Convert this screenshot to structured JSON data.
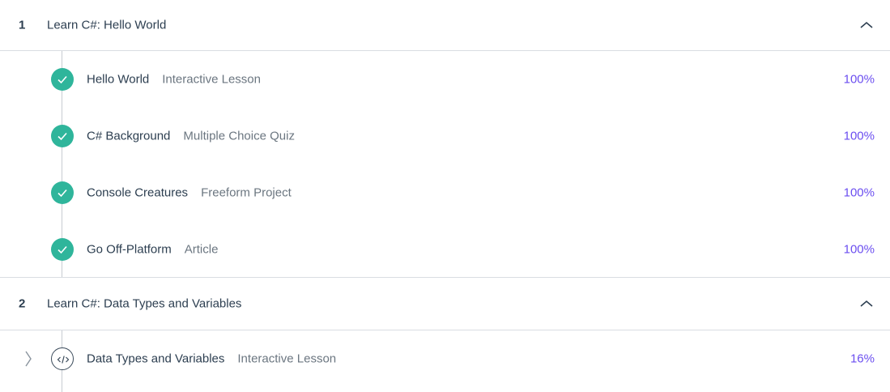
{
  "sections": [
    {
      "number": "1",
      "title": "Learn C#: Hello World",
      "items": [
        {
          "title": "Hello World",
          "type": "Interactive Lesson",
          "progress": "100%",
          "status": "complete"
        },
        {
          "title": "C# Background",
          "type": "Multiple Choice Quiz",
          "progress": "100%",
          "status": "complete"
        },
        {
          "title": "Console Creatures",
          "type": "Freeform Project",
          "progress": "100%",
          "status": "complete"
        },
        {
          "title": "Go Off-Platform",
          "type": "Article",
          "progress": "100%",
          "status": "complete"
        }
      ]
    },
    {
      "number": "2",
      "title": "Learn C#: Data Types and Variables",
      "items": [
        {
          "title": "Data Types and Variables",
          "type": "Interactive Lesson",
          "progress": "16%",
          "status": "in-progress"
        }
      ]
    }
  ],
  "colors": {
    "complete": "#2fb59b",
    "progress_text": "#6b4ef0",
    "divider": "#d9dde2"
  },
  "icons": {
    "section_toggle": "chevron-up-icon",
    "complete": "check-circle-icon",
    "lesson": "code-icon",
    "expand": "chevron-right-icon"
  }
}
